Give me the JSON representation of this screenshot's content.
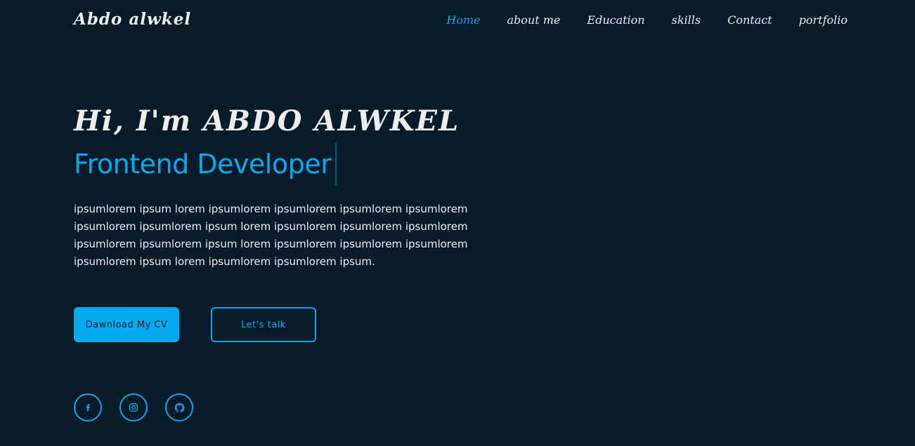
{
  "brand": "Abdo alwkel",
  "nav": {
    "items": [
      {
        "label": "Home",
        "active": true
      },
      {
        "label": "about me"
      },
      {
        "label": "Education"
      },
      {
        "label": "skills"
      },
      {
        "label": "Contact"
      },
      {
        "label": "portfolio"
      }
    ]
  },
  "hero": {
    "greeting": "Hi, I'm ABDO ALWKEL",
    "role": "Frontend Developer",
    "about": "ipsumlorem ipsum lorem ipsumlorem ipsumlorem ipsumlorem ipsumlorem ipsumlorem ipsumlorem ipsum lorem ipsumlorem ipsumlorem ipsumlorem ipsumlorem ipsumlorem ipsum lorem ipsumlorem ipsumlorem ipsumlorem ipsumlorem ipsum lorem ipsumlorem ipsumlorem ipsum."
  },
  "buttons": {
    "cv": "Dawnload My CV",
    "talk": "Let's talk"
  },
  "socials": [
    {
      "icon": "facebook-icon"
    },
    {
      "icon": "instagram-icon"
    },
    {
      "icon": "github-icon"
    }
  ],
  "colors": {
    "background": "#081b29",
    "accent": "#00abf0",
    "text": "#ededed"
  }
}
